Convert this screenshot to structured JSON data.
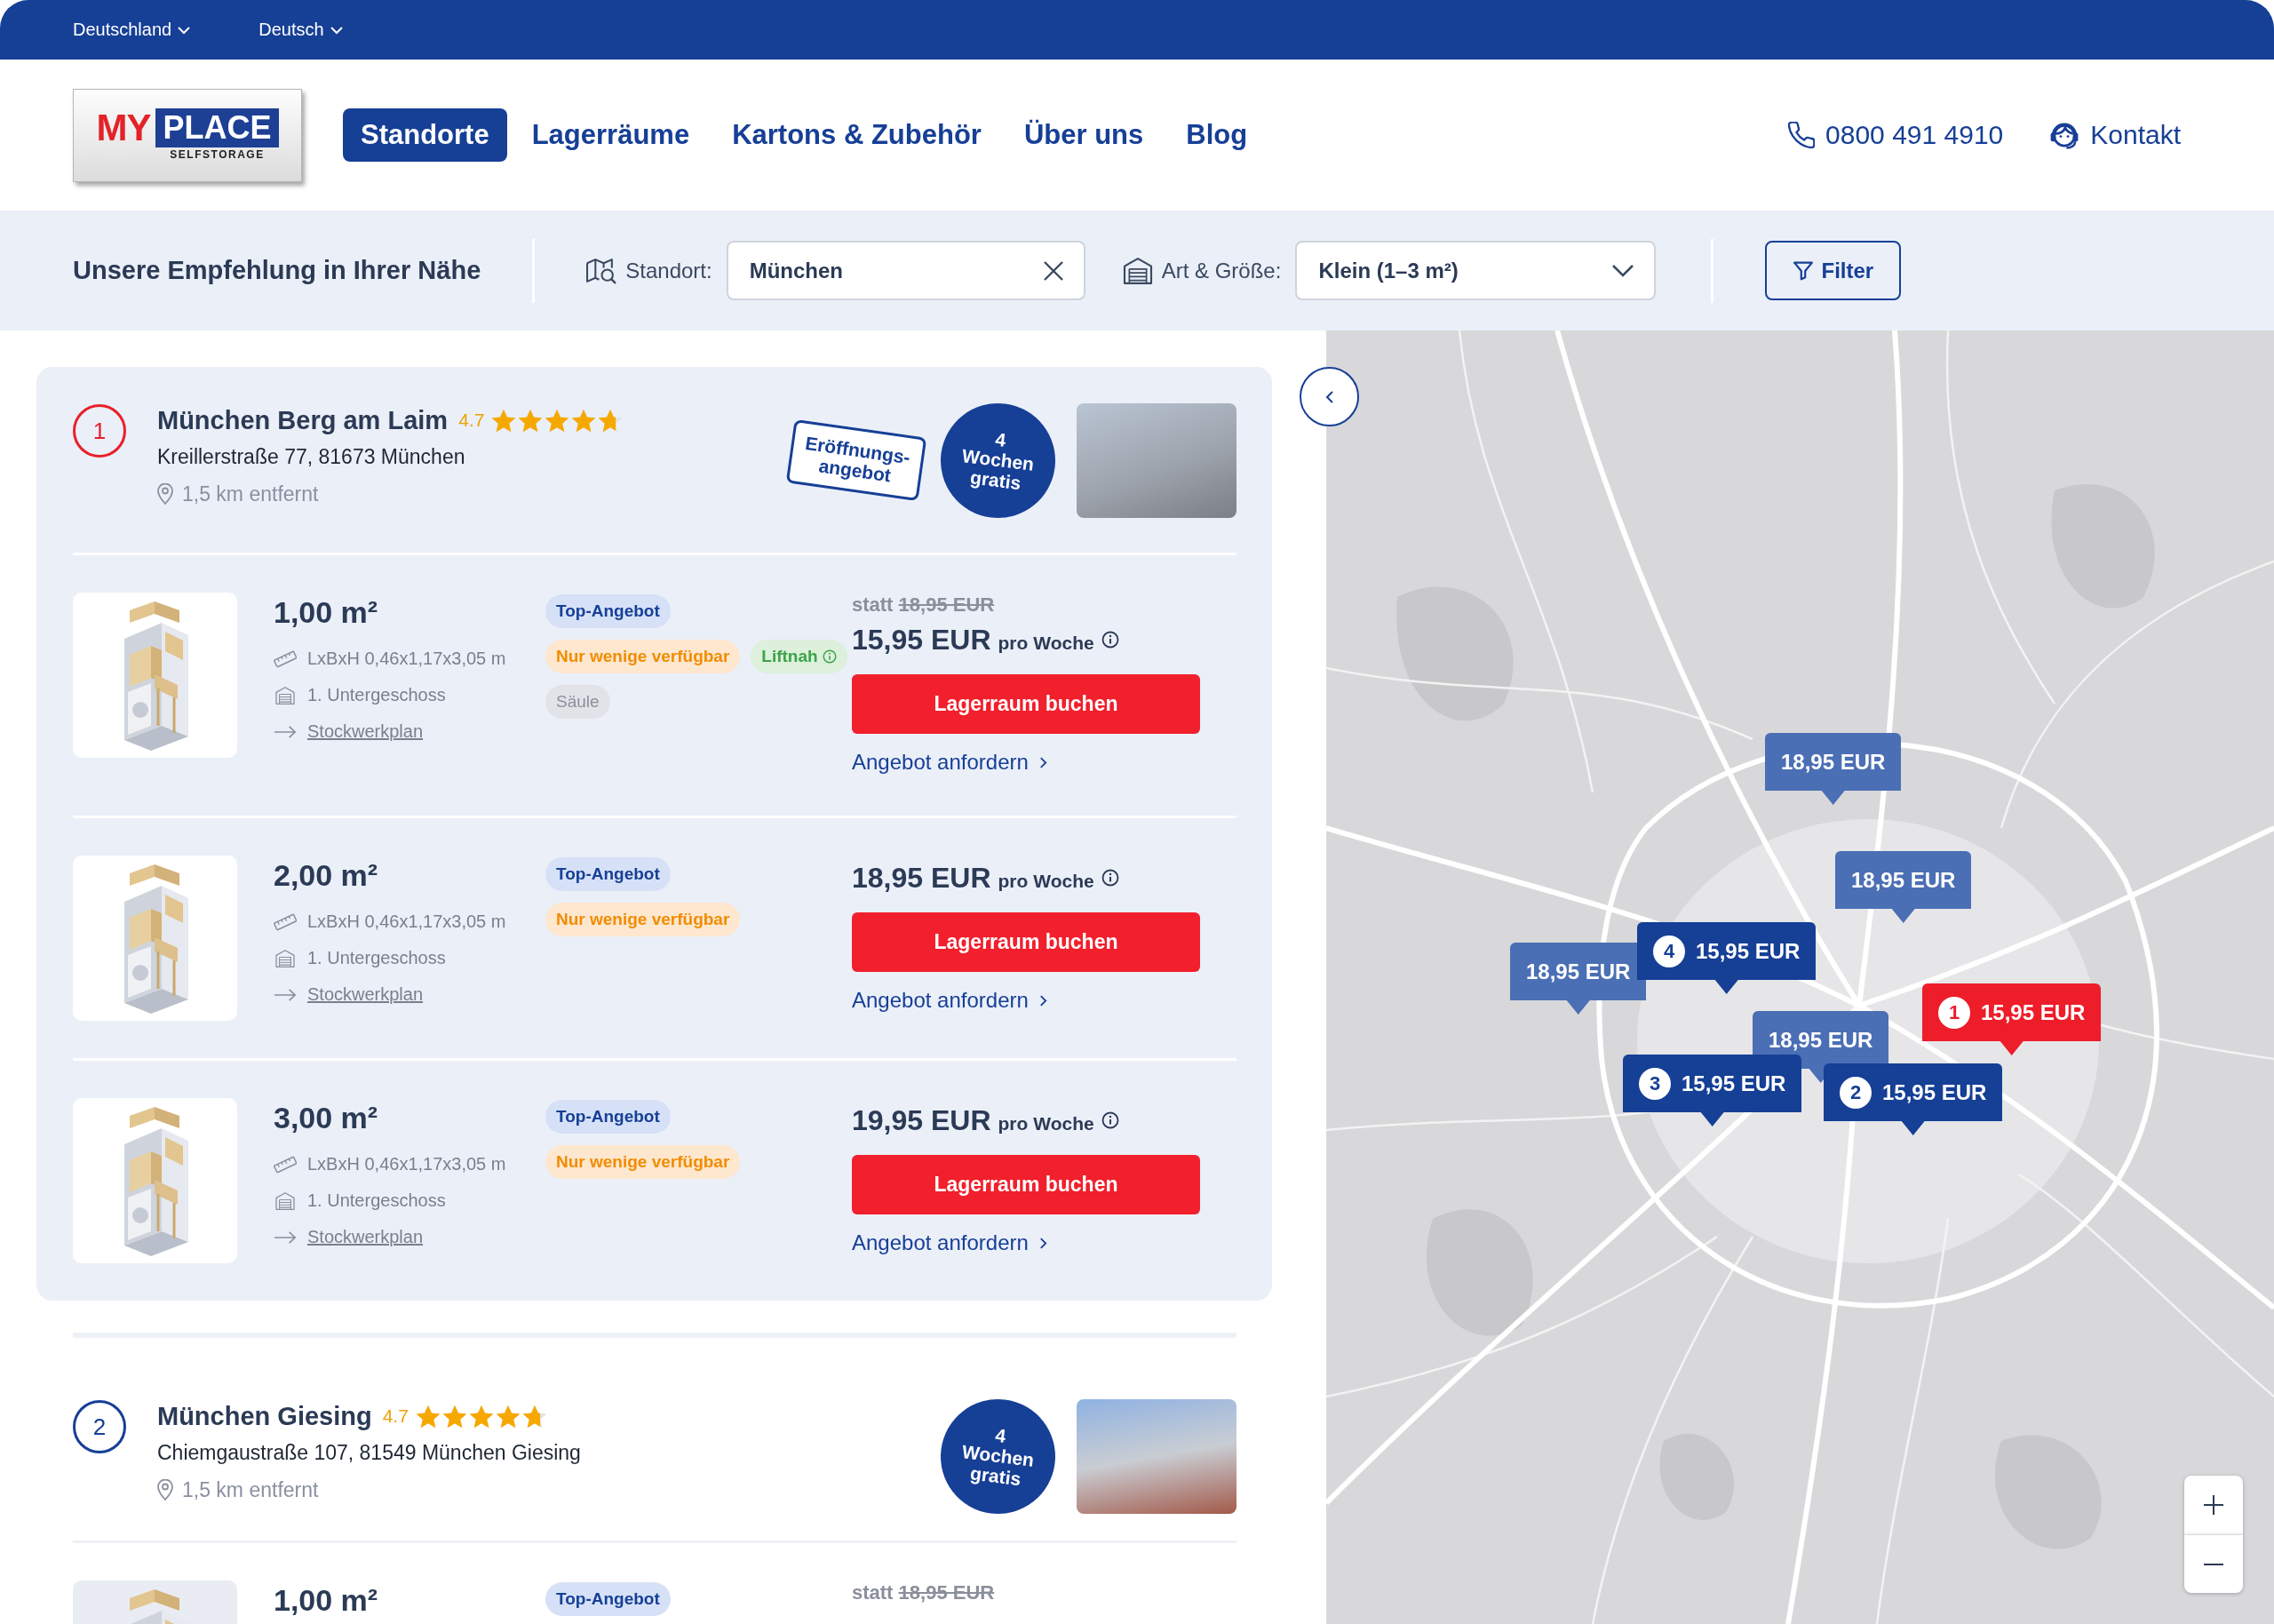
{
  "top_bar": {
    "items": [
      {
        "label": "Deutschland"
      },
      {
        "label": "Deutsch"
      }
    ]
  },
  "header": {
    "logo": {
      "prefix": "MY",
      "name": "PLACE",
      "tagline": "SELFSTORAGE"
    },
    "nav": [
      {
        "label": "Standorte",
        "selected": true
      },
      {
        "label": "Lagerräume",
        "selected": false
      },
      {
        "label": "Kartons & Zubehör",
        "selected": false
      },
      {
        "label": "Über uns",
        "selected": false
      },
      {
        "label": "Blog",
        "selected": false
      }
    ],
    "phone": "0800 491 4910",
    "contact": "Kontakt"
  },
  "search_bar": {
    "title": "Unsere Empfehlung in Ihrer Nähe",
    "location": {
      "label": "Standort:",
      "value": "München"
    },
    "size": {
      "label": "Art & Größe:",
      "value": "Klein (1–3 m²)"
    },
    "filter": "Filter"
  },
  "locations": [
    {
      "number": "1",
      "selected": true,
      "name": "München Berg am Laim",
      "rating": "4.7",
      "stars": 4.7,
      "address": "Kreillerstraße 77, 81673 München",
      "distance": "1,5 km entfernt",
      "badges": [
        {
          "kind": "opening",
          "text": "Eröffnungs-angebot"
        },
        {
          "kind": "promo",
          "text": "4 Wochen gratis"
        }
      ],
      "units": [
        {
          "size": "1,00 m²",
          "details": [
            {
              "kind": "dimensions",
              "text": "LxBxH 0,46x1,17x3,05 m"
            },
            {
              "kind": "floor",
              "text": "1. Untergeschoss"
            },
            {
              "kind": "plan",
              "text": "Stockwerkplan"
            }
          ],
          "tags": [
            {
              "kind": "top",
              "text": "Top-Angebot",
              "info": false
            },
            {
              "kind": "scarce",
              "text": "Nur wenige verfügbar",
              "info": false
            },
            {
              "kind": "feature",
              "text": "Liftnah",
              "info": true
            },
            {
              "kind": "neutral",
              "text": "Säule",
              "info": false
            }
          ],
          "was_label": "statt",
          "was_price": "18,95 EUR",
          "price": "15,95 EUR",
          "unit": "pro Woche",
          "book": "Lagerraum buchen",
          "quote": "Angebot anfordern"
        },
        {
          "size": "2,00 m²",
          "details": [
            {
              "kind": "dimensions",
              "text": "LxBxH 0,46x1,17x3,05 m"
            },
            {
              "kind": "floor",
              "text": "1. Untergeschoss"
            },
            {
              "kind": "plan",
              "text": "Stockwerkplan"
            }
          ],
          "tags": [
            {
              "kind": "top",
              "text": "Top-Angebot",
              "info": false
            },
            {
              "kind": "scarce",
              "text": "Nur wenige verfügbar",
              "info": false
            }
          ],
          "price": "18,95 EUR",
          "unit": "pro Woche",
          "book": "Lagerraum buchen",
          "quote": "Angebot anfordern"
        },
        {
          "size": "3,00 m²",
          "details": [
            {
              "kind": "dimensions",
              "text": "LxBxH 0,46x1,17x3,05 m"
            },
            {
              "kind": "floor",
              "text": "1. Untergeschoss"
            },
            {
              "kind": "plan",
              "text": "Stockwerkplan"
            }
          ],
          "tags": [
            {
              "kind": "top",
              "text": "Top-Angebot",
              "info": false
            },
            {
              "kind": "scarce",
              "text": "Nur wenige verfügbar",
              "info": false
            }
          ],
          "price": "19,95 EUR",
          "unit": "pro Woche",
          "book": "Lagerraum buchen",
          "quote": "Angebot anfordern"
        }
      ]
    },
    {
      "number": "2",
      "selected": false,
      "name": "München Giesing",
      "rating": "4.7",
      "stars": 4.7,
      "address": "Chiemgaustraße 107, 81549 München Giesing",
      "distance": "1,5 km entfernt",
      "badges": [
        {
          "kind": "promo",
          "text": "4 Wochen gratis"
        }
      ],
      "units": [
        {
          "size": "1,00 m²",
          "tags": [
            {
              "kind": "top",
              "text": "Top-Angebot",
              "info": false
            }
          ],
          "was_label": "statt",
          "was_price": "18,95 EUR"
        }
      ]
    }
  ],
  "map": {
    "markers": [
      {
        "kind": "other",
        "price": "18,95 EUR",
        "selected": false
      },
      {
        "kind": "other",
        "price": "18,95 EUR",
        "selected": false
      },
      {
        "kind": "other",
        "price": "18,95 EUR",
        "selected": false
      },
      {
        "kind": "other",
        "price": "18,95 EUR",
        "selected": false
      },
      {
        "kind": "listed",
        "number": "4",
        "price": "15,95 EUR",
        "selected": false
      },
      {
        "kind": "listed",
        "number": "3",
        "price": "15,95 EUR",
        "selected": false
      },
      {
        "kind": "listed",
        "number": "2",
        "price": "15,95 EUR",
        "selected": false
      },
      {
        "kind": "listed",
        "number": "1",
        "price": "15,95 EUR",
        "selected": true
      }
    ]
  }
}
